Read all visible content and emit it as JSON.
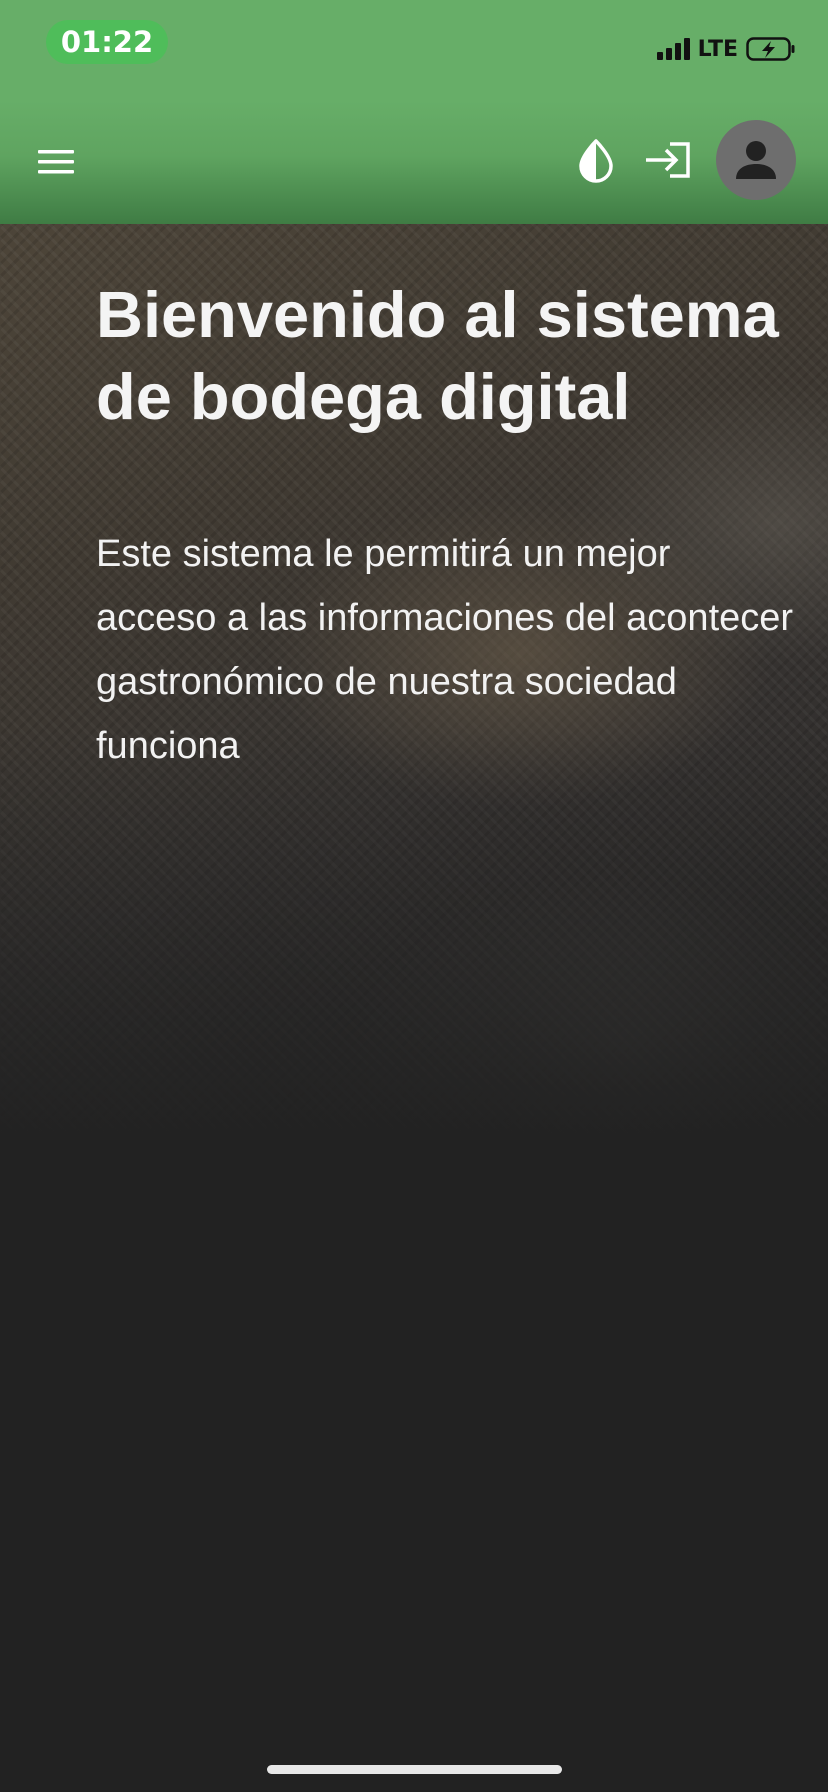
{
  "status_bar": {
    "time": "01:22",
    "network": "LTE",
    "signal_icon": "cellular-signal-icon",
    "battery_icon": "battery-charging-icon",
    "background_color": "#67ae68",
    "time_pill_color": "#4fbd5a"
  },
  "app_bar": {
    "menu_icon": "hamburger-menu-icon",
    "contrast_icon": "contrast-drop-icon",
    "login_icon": "login-icon",
    "avatar_icon": "person-icon",
    "background_color": "#5fa460"
  },
  "hero": {
    "title": "Bienvenido al sistema de bodega digital",
    "description": "Este sistema le permitirá un mejor acceso a las informaciones del acontecer gastronómico de nuestra sociedad funciona"
  },
  "page": {
    "background_color": "#222222"
  }
}
